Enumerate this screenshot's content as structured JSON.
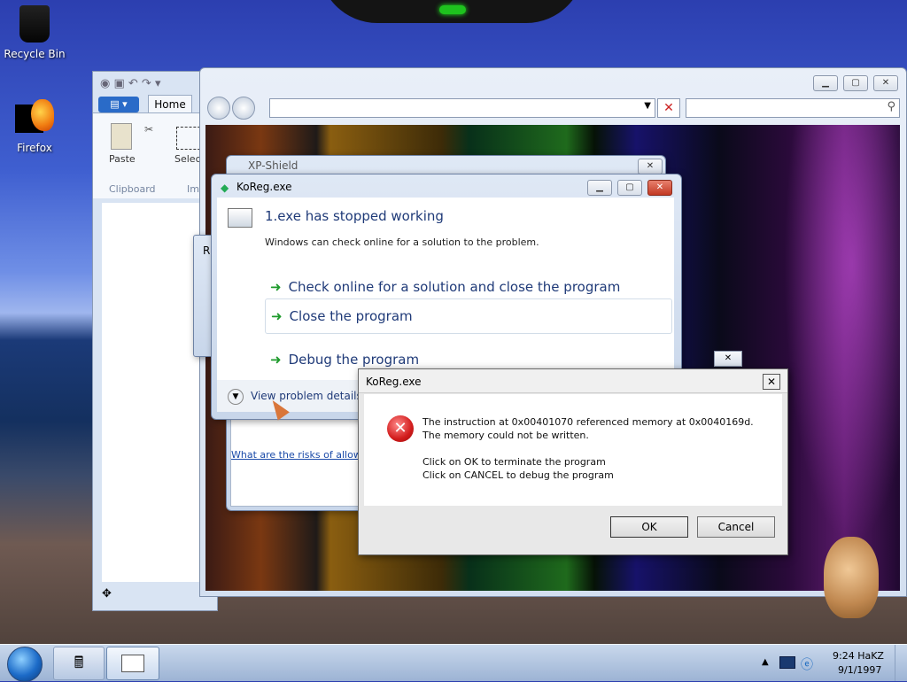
{
  "desktop": {
    "icons": [
      {
        "label": "Recycle Bin",
        "icon": "recycle-bin-icon"
      },
      {
        "label": "Firefox",
        "icon": "firefox-icon"
      }
    ]
  },
  "paint": {
    "tab_home": "Home",
    "paste": "Paste",
    "select": "Select",
    "group_clipboard": "Clipboard",
    "group_image_partial": "Im"
  },
  "explorer": {
    "address_value": "",
    "search_placeholder": ""
  },
  "xpshield": {
    "title": "XP-Shield",
    "risk_link": "What are the risks of allowing"
  },
  "stopped_dialog": {
    "title": "KoReg.exe",
    "heading": "1.exe has stopped working",
    "subtext": "Windows can check online for a solution to the problem.",
    "options": [
      "Check online for a solution and close the program",
      "Close the program",
      "Debug the program"
    ],
    "details": "View problem details"
  },
  "error_dialog": {
    "title": "KoReg.exe",
    "message1": "The instruction at 0x00401070 referenced memory at 0x0040169d. The memory could not be written.",
    "message2": "Click on OK to terminate the program",
    "message3": "Click on CANCEL to debug the program",
    "ok": "OK",
    "cancel": "Cancel"
  },
  "taskbar": {
    "time": "9:24 HaKZ",
    "date": "9/1/1997"
  }
}
